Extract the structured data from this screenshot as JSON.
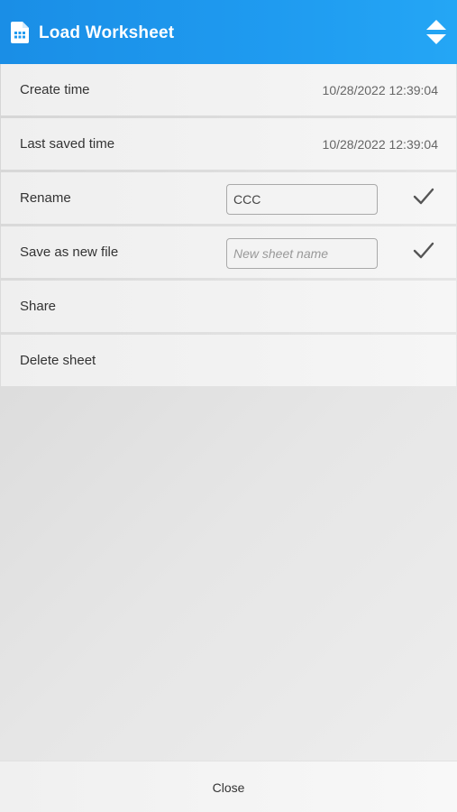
{
  "header": {
    "title": "Load Worksheet",
    "icon": "document-icon",
    "sort_icon": "sort-up-down-icon",
    "colors": {
      "background": "#1f9bf0",
      "text": "#ffffff"
    }
  },
  "info": {
    "create_time_label": "Create time",
    "create_time_value": "10/28/2022 12:39:04",
    "last_saved_label": "Last saved time",
    "last_saved_value": "10/28/2022 12:39:04"
  },
  "rename": {
    "label": "Rename",
    "value": "CCC",
    "confirm_icon": "checkmark-icon"
  },
  "save_as": {
    "label": "Save as new file",
    "value": "",
    "placeholder": "New sheet name",
    "confirm_icon": "checkmark-icon"
  },
  "actions": {
    "share_label": "Share",
    "delete_label": "Delete sheet"
  },
  "footer": {
    "close_label": "Close"
  }
}
